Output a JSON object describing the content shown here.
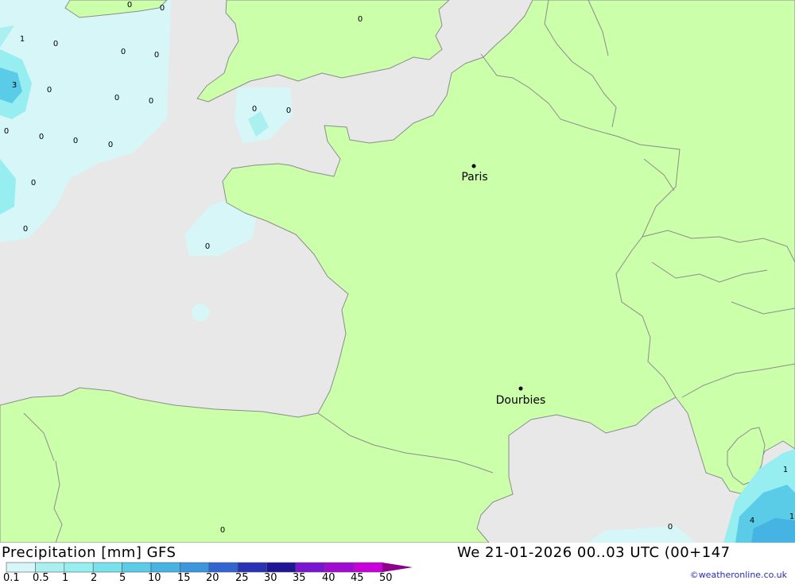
{
  "map": {
    "cities": [
      {
        "name": "Paris"
      },
      {
        "name": "Dourbies"
      }
    ],
    "contour_labels": [
      "0",
      "0",
      "0",
      "1",
      "0",
      "0",
      "0",
      "3",
      "0",
      "0",
      "0",
      "0",
      "0",
      "0",
      "0",
      "0",
      "0",
      "0",
      "0",
      "0",
      "0",
      "0",
      "1",
      "4",
      "1"
    ],
    "colors": {
      "sea": "#e8e8e8",
      "land": "#ccffaa",
      "border": "#8c8c8c",
      "precip_light": "#d6f6f8",
      "precip_mid": "#96eef0",
      "precip_strong": "#5acce8",
      "precip_heavy": "#3ca0dc"
    }
  },
  "footer": {
    "title": "Precipitation [mm] GFS",
    "datetime": "We 21-01-2026 00..03 UTC (00+147",
    "copyright": "©weatheronline.co.uk"
  },
  "legend": {
    "ticks": [
      "0.1",
      "0.5",
      "1",
      "2",
      "5",
      "10",
      "15",
      "20",
      "25",
      "30",
      "35",
      "40",
      "45",
      "50"
    ],
    "colors": [
      "#d6f6f8",
      "#aaf0f0",
      "#96eef0",
      "#78e2ec",
      "#5acce8",
      "#46b4e2",
      "#3c96dc",
      "#3264d2",
      "#2832b4",
      "#1e1496",
      "#7814d2",
      "#a00ad2",
      "#c800dc",
      "#b400b4",
      "#8c008c"
    ]
  }
}
